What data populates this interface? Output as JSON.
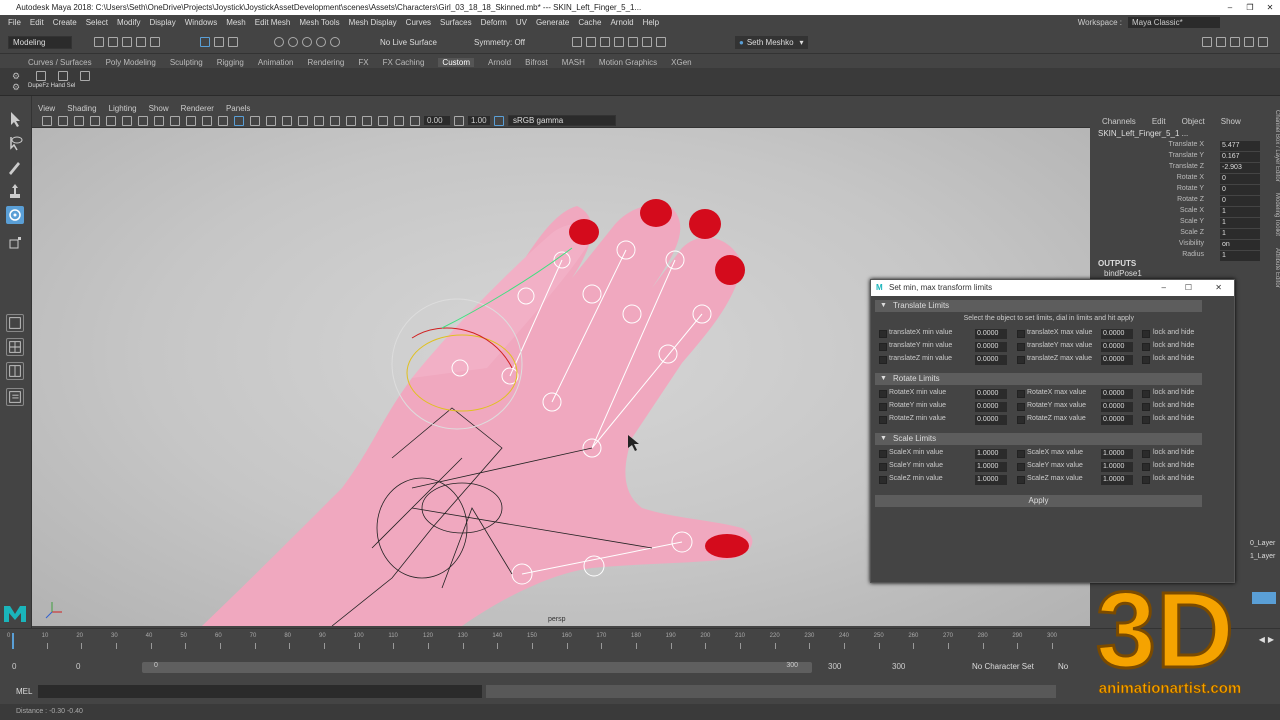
{
  "window": {
    "title": "Autodesk Maya 2018: C:\\Users\\Seth\\OneDrive\\Projects\\Joystick\\JoystickAssetDevelopment\\scenes\\Assets\\Characters\\Girl_03_18_18_Skinned.mb*  ---  SKIN_Left_Finger_5_1..."
  },
  "menubar": [
    "File",
    "Edit",
    "Create",
    "Select",
    "Modify",
    "Display",
    "Windows",
    "Mesh",
    "Edit Mesh",
    "Mesh Tools",
    "Mesh Display",
    "Curves",
    "Surfaces",
    "Deform",
    "UV",
    "Generate",
    "Cache",
    "Arnold",
    "Help"
  ],
  "workspace": {
    "label": "Workspace :",
    "value": "Maya Classic*"
  },
  "statusline": {
    "mode": "Modeling",
    "live_surface": "No Live Surface",
    "symmetry": "Symmetry: Off",
    "user": "Seth Meshko"
  },
  "shelf": {
    "tabs": [
      "Curves / Surfaces",
      "Poly Modeling",
      "Sculpting",
      "Rigging",
      "Animation",
      "Rendering",
      "FX",
      "FX Caching",
      "Custom",
      "Arnold",
      "Bifrost",
      "MASH",
      "Motion Graphics",
      "XGen"
    ],
    "active": "Custom",
    "button_label": "DupeFz Hand Sel"
  },
  "viewport": {
    "menu": [
      "View",
      "Shading",
      "Lighting",
      "Show",
      "Renderer",
      "Panels"
    ],
    "near": "0.00",
    "far": "1.00",
    "colorspace": "sRGB gamma",
    "camera": "persp"
  },
  "channelbox": {
    "tabs": [
      "Channels",
      "Edit",
      "Object",
      "Show"
    ],
    "object": "SKIN_Left_Finger_5_1 ...",
    "attrs": [
      {
        "name": "Translate X",
        "value": "5.477"
      },
      {
        "name": "Translate Y",
        "value": "0.167"
      },
      {
        "name": "Translate Z",
        "value": "-2.903"
      },
      {
        "name": "Rotate X",
        "value": "0"
      },
      {
        "name": "Rotate Y",
        "value": "0"
      },
      {
        "name": "Rotate Z",
        "value": "0"
      },
      {
        "name": "Scale X",
        "value": "1"
      },
      {
        "name": "Scale Y",
        "value": "1"
      },
      {
        "name": "Scale Z",
        "value": "1"
      },
      {
        "name": "Visibility",
        "value": "on"
      },
      {
        "name": "Radius",
        "value": "1"
      }
    ],
    "outputs_label": "OUTPUTS",
    "outputs_item": "bindPose1",
    "layers": [
      "0_Layer",
      "1_Layer"
    ]
  },
  "side_tabs": [
    "Channel Box / Layer Editor",
    "Modeling Toolkit",
    "Attribute Editor"
  ],
  "dialog": {
    "title": "Set min, max transform limits",
    "hint": "Select the object to set limits, dial in limits and hit apply",
    "lock_label": "lock and hide",
    "sections": [
      {
        "title": "Translate Limits",
        "rows": [
          {
            "min_label": "translateX min value",
            "min": "0.0000",
            "max_label": "translateX max value",
            "max": "0.0000"
          },
          {
            "min_label": "translateY min value",
            "min": "0.0000",
            "max_label": "translateY max value",
            "max": "0.0000"
          },
          {
            "min_label": "translateZ min value",
            "min": "0.0000",
            "max_label": "translateZ max value",
            "max": "0.0000"
          }
        ]
      },
      {
        "title": "Rotate Limits",
        "rows": [
          {
            "min_label": "RotateX min value",
            "min": "0.0000",
            "max_label": "RotateX max value",
            "max": "0.0000"
          },
          {
            "min_label": "RotateY min value",
            "min": "0.0000",
            "max_label": "RotateY max value",
            "max": "0.0000"
          },
          {
            "min_label": "RotateZ min value",
            "min": "0.0000",
            "max_label": "RotateZ max value",
            "max": "0.0000"
          }
        ]
      },
      {
        "title": "Scale Limits",
        "rows": [
          {
            "min_label": "ScaleX min value",
            "min": "1.0000",
            "max_label": "ScaleX max value",
            "max": "1.0000"
          },
          {
            "min_label": "ScaleY min value",
            "min": "1.0000",
            "max_label": "ScaleY max value",
            "max": "1.0000"
          },
          {
            "min_label": "ScaleZ min value",
            "min": "1.0000",
            "max_label": "ScaleZ max value",
            "max": "1.0000"
          }
        ]
      }
    ],
    "apply": "Apply"
  },
  "timeline": {
    "ticks": [
      "0",
      "10",
      "20",
      "30",
      "40",
      "50",
      "60",
      "70",
      "80",
      "90",
      "100",
      "110",
      "120",
      "130",
      "140",
      "150",
      "160",
      "170",
      "180",
      "190",
      "200",
      "210",
      "220",
      "230",
      "240",
      "250",
      "260",
      "270",
      "280",
      "290",
      "300"
    ],
    "start": "0",
    "range_start": "0",
    "range_inner_start": "0",
    "range_inner_end": "300",
    "range_end": "300",
    "end": "300",
    "char_set": "No Character Set",
    "anim_layer": "No"
  },
  "cmdline": {
    "lang": "MEL"
  },
  "helpline": {
    "text": "Distance : -0.30    -0.40"
  },
  "watermark": {
    "big": "3D",
    "url": "animationartist.com"
  },
  "colors": {
    "skin": "#f0a8bf",
    "nail": "#d40b1c",
    "accent": "#5a9fd6",
    "bg": "#444444"
  }
}
